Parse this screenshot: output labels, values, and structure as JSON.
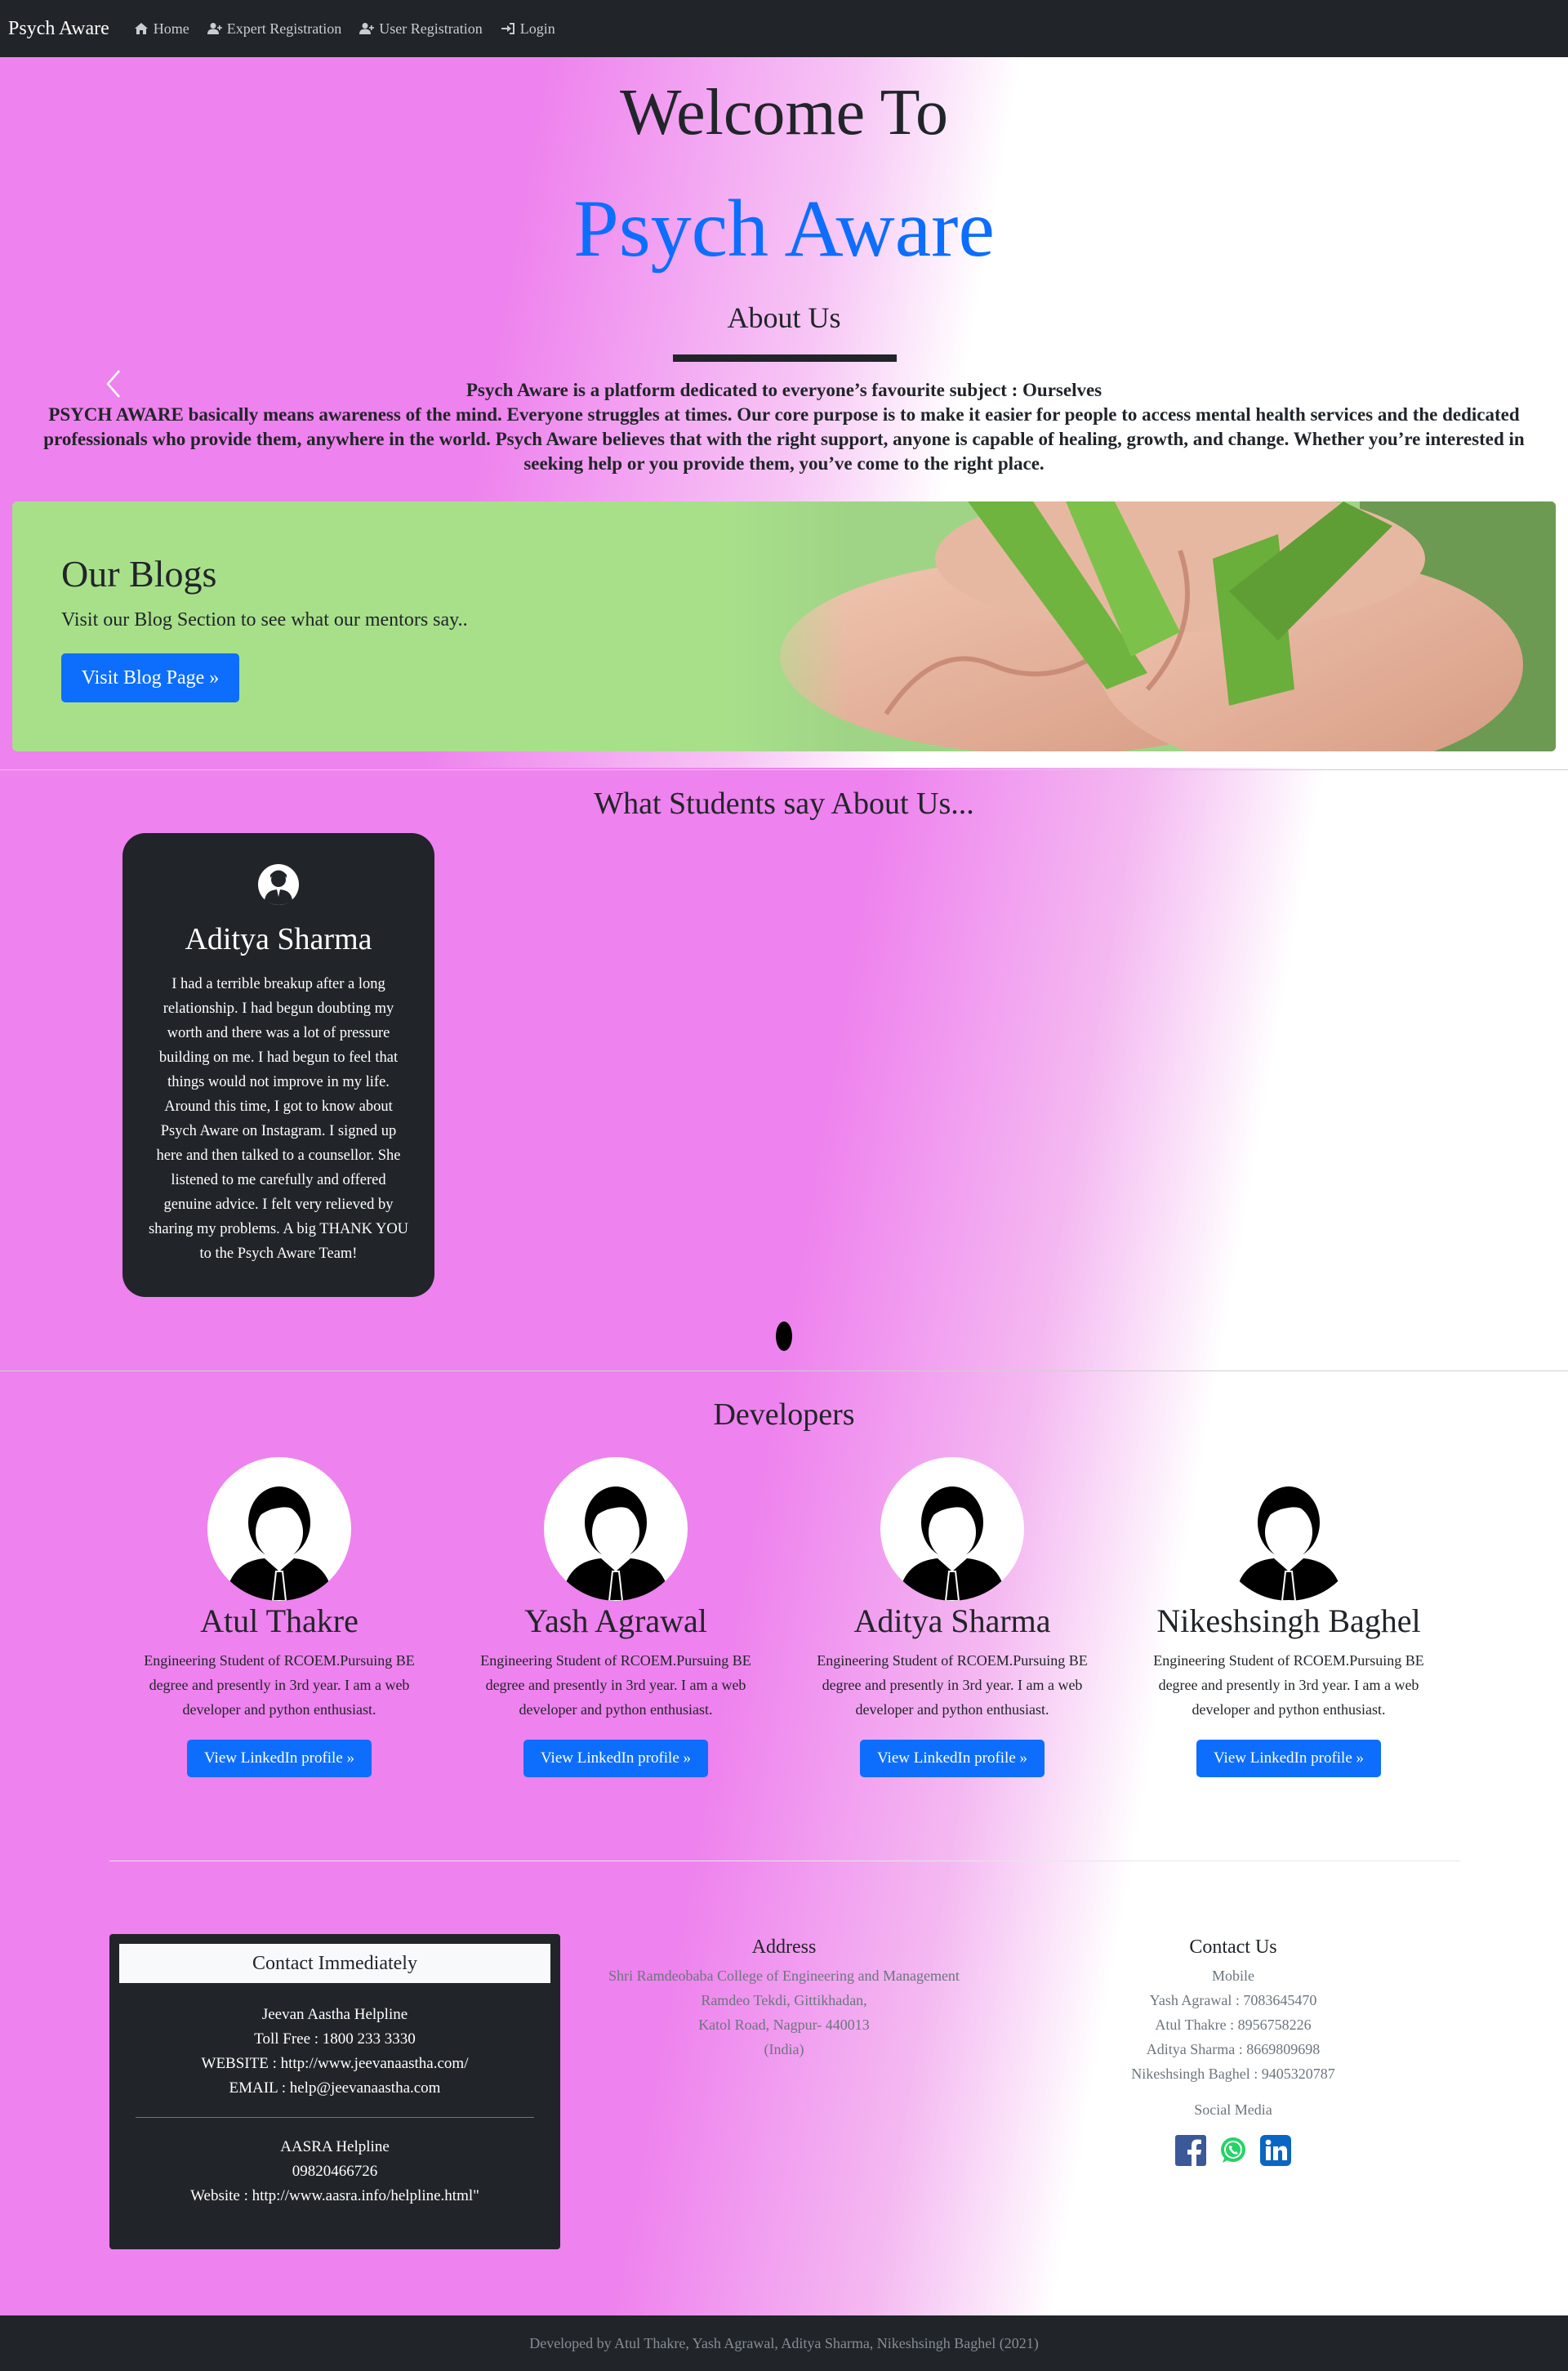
{
  "navbar": {
    "brand": "Psych Aware",
    "items": [
      {
        "label": "Home",
        "icon": "home-icon"
      },
      {
        "label": "Expert Registration",
        "icon": "user-plus-icon"
      },
      {
        "label": "User Registration",
        "icon": "user-plus-icon"
      },
      {
        "label": "Login",
        "icon": "sign-in-icon"
      }
    ]
  },
  "hero": {
    "welcome": "Welcome To",
    "title": "Psych Aware",
    "about_heading": "About Us",
    "about_line1": "Psych Aware is a platform dedicated to everyone’s favourite subject : Ourselves",
    "about_text": "PSYCH AWARE basically means awareness of the mind. Everyone struggles at times. Our core purpose is to make it easier for people to access mental health services and the dedicated professionals who provide them, anywhere in the world. Psych Aware believes that with the right support, anyone is capable of healing, growth, and change. Whether you’re interested in seeking help or you provide them, you’ve come to the right place."
  },
  "blog": {
    "title": "Our Blogs",
    "subtitle": "Visit our Blog Section to see what our mentors say..",
    "button": "Visit Blog Page »"
  },
  "testimonials": {
    "heading": "What Students say About Us...",
    "items": [
      {
        "name": "Aditya Sharma",
        "text": "I had a terrible breakup after a long relationship. I had begun doubting my worth and there was a lot of pressure building on me. I had begun to feel that things would not improve in my life. Around this time, I got to know about Psych Aware on Instagram. I signed up here and then talked to a counsellor. She listened to me carefully and offered genuine advice. I felt very relieved by sharing my problems. A big THANK YOU to the Psych Aware Team!"
      }
    ]
  },
  "developers": {
    "heading": "Developers",
    "items": [
      {
        "name": "Atul Thakre",
        "desc": "Engineering Student of RCOEM.Pursuing BE degree and presently in 3rd year. I am a web developer and python enthusiast.",
        "button": "View LinkedIn profile »"
      },
      {
        "name": "Yash Agrawal",
        "desc": "Engineering Student of RCOEM.Pursuing BE degree and presently in 3rd year. I am a web developer and python enthusiast.",
        "button": "View LinkedIn profile »"
      },
      {
        "name": "Aditya Sharma",
        "desc": "Engineering Student of RCOEM.Pursuing BE degree and presently in 3rd year. I am a web developer and python enthusiast.",
        "button": "View LinkedIn profile »"
      },
      {
        "name": "Nikeshsingh Baghel",
        "desc": "Engineering Student of RCOEM.Pursuing BE degree and presently in 3rd year. I am a web developer and python enthusiast.",
        "button": "View LinkedIn profile »"
      }
    ]
  },
  "contact_immediately": {
    "heading": "Contact Immediately",
    "helpline1": [
      "Jeevan Aastha Helpline",
      "Toll Free : 1800 233 3330",
      "WEBSITE : http://www.jeevanaastha.com/",
      "EMAIL : help@jeevanaastha.com"
    ],
    "helpline2": [
      "AASRA Helpline",
      "09820466726",
      "Website : http://www.aasra.info/helpline.html\""
    ]
  },
  "address": {
    "heading": "Address",
    "lines": [
      "Shri Ramdeobaba College of Engineering and Management",
      "Ramdeo Tekdi, Gittikhadan,",
      "Katol Road, Nagpur- 440013",
      "(India)"
    ]
  },
  "contact_us": {
    "heading": "Contact Us",
    "mobile_label": "Mobile",
    "numbers": [
      "Yash Agrawal : 7083645470",
      "Atul Thakre : 8956758226",
      "Aditya Sharma : 8669809698",
      "Nikeshsingh Baghel : 9405320787"
    ],
    "social_label": "Social Media",
    "social_icons": [
      "facebook-icon",
      "whatsapp-icon",
      "linkedin-icon"
    ],
    "colors": {
      "facebook": "#3b5998",
      "whatsapp": "#25d366",
      "linkedin": "#0a66c2"
    }
  },
  "footer": {
    "text": "Developed by Atul Thakre, Yash Agrawal, Aditya Sharma, Nikeshsingh Baghel (2021)"
  },
  "colors": {
    "accent": "#0d6efd",
    "dark": "#212529",
    "pink": "#ee82ee"
  }
}
